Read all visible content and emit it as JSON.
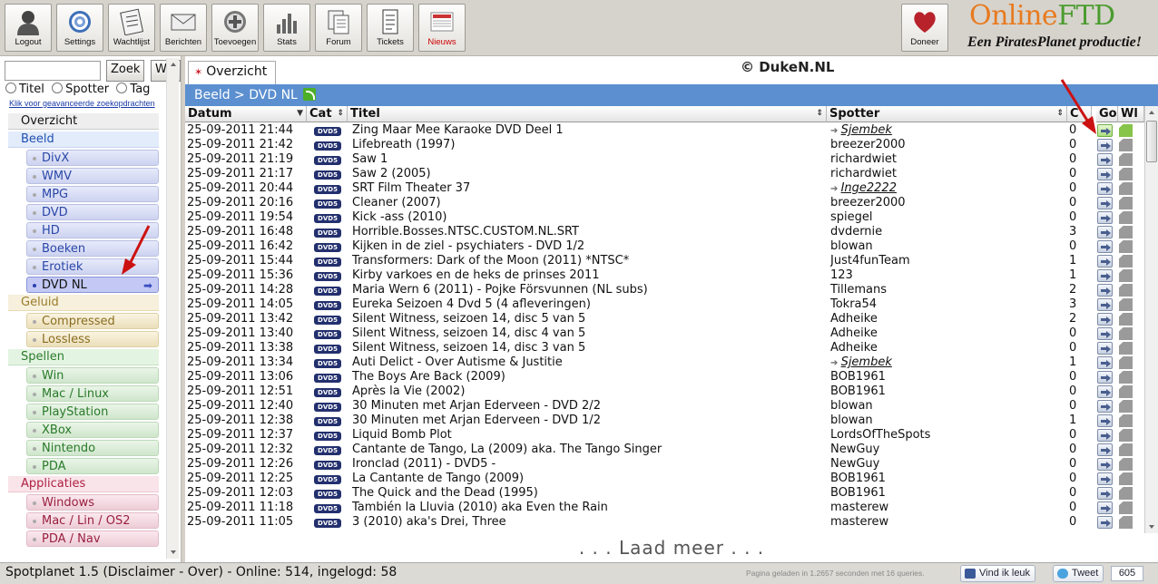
{
  "toolbar": {
    "buttons": [
      {
        "id": "logout",
        "label": "Logout",
        "icon": "user-icon"
      },
      {
        "id": "settings",
        "label": "Settings",
        "icon": "settings-icon"
      },
      {
        "id": "wachtlijst",
        "label": "Wachtlijst",
        "icon": "checklist-icon"
      },
      {
        "id": "berichten",
        "label": "Berichten",
        "icon": "envelope-icon"
      },
      {
        "id": "toevoegen",
        "label": "Toevoegen",
        "icon": "add-icon"
      },
      {
        "id": "stats",
        "label": "Stats",
        "icon": "bar-chart-icon"
      },
      {
        "id": "forum",
        "label": "Forum",
        "icon": "documents-icon"
      },
      {
        "id": "tickets",
        "label": "Tickets",
        "icon": "ticket-icon"
      },
      {
        "id": "nieuws",
        "label": "Nieuws",
        "icon": "newspaper-icon"
      }
    ],
    "donate_label": "Doneer",
    "brand_online": "Online",
    "brand_ftd": "FTD",
    "brand_tagline": "Een PiratesPlanet productie!"
  },
  "sidebar": {
    "search_value": "",
    "zoek_label": "Zoek",
    "wis_label": "Wis",
    "radio_titel": "Titel",
    "radio_spotter": "Spotter",
    "radio_tag": "Tag",
    "advanced_link": "Klik voor geavanceerde zoekopdrachten",
    "nav": [
      {
        "type": "main",
        "label": "Overzicht",
        "cls": "c-overzicht"
      },
      {
        "type": "main",
        "label": "Beeld",
        "cls": "c-beeld"
      },
      {
        "type": "sub",
        "label": "DivX",
        "cls": "c-beeld-sub"
      },
      {
        "type": "sub",
        "label": "WMV",
        "cls": "c-beeld-sub"
      },
      {
        "type": "sub",
        "label": "MPG",
        "cls": "c-beeld-sub"
      },
      {
        "type": "sub",
        "label": "DVD",
        "cls": "c-beeld-sub"
      },
      {
        "type": "sub",
        "label": "HD",
        "cls": "c-beeld-sub"
      },
      {
        "type": "sub",
        "label": "Boeken",
        "cls": "c-beeld-sub"
      },
      {
        "type": "sub",
        "label": "Erotiek",
        "cls": "c-beeld-sub"
      },
      {
        "type": "sub",
        "label": "DVD NL",
        "cls": "c-dvdnl",
        "active": true
      },
      {
        "type": "main",
        "label": "Geluid",
        "cls": "c-geluid"
      },
      {
        "type": "sub",
        "label": "Compressed",
        "cls": "c-geluid-sub"
      },
      {
        "type": "sub",
        "label": "Lossless",
        "cls": "c-geluid-sub"
      },
      {
        "type": "main",
        "label": "Spellen",
        "cls": "c-spellen"
      },
      {
        "type": "sub",
        "label": "Win",
        "cls": "c-spellen-sub"
      },
      {
        "type": "sub",
        "label": "Mac / Linux",
        "cls": "c-spellen-sub"
      },
      {
        "type": "sub",
        "label": "PlayStation",
        "cls": "c-spellen-sub"
      },
      {
        "type": "sub",
        "label": "XBox",
        "cls": "c-spellen-sub"
      },
      {
        "type": "sub",
        "label": "Nintendo",
        "cls": "c-spellen-sub"
      },
      {
        "type": "sub",
        "label": "PDA",
        "cls": "c-spellen-sub"
      },
      {
        "type": "main",
        "label": "Applicaties",
        "cls": "c-app"
      },
      {
        "type": "sub",
        "label": "Windows",
        "cls": "c-app-sub"
      },
      {
        "type": "sub",
        "label": "Mac / Lin / OS2",
        "cls": "c-app-sub"
      },
      {
        "type": "sub",
        "label": "PDA / Nav",
        "cls": "c-app-sub"
      }
    ]
  },
  "main": {
    "tab_label": "Overzicht",
    "watermark": "© DukeN.NL",
    "breadcrumb": "Beeld > DVD NL",
    "columns": {
      "datum": "Datum",
      "cat": "Cat",
      "titel": "Titel",
      "spotter": "Spotter",
      "c": "C",
      "go": "Go",
      "wl": "Wl"
    },
    "category_badge": "DVD5",
    "rows": [
      {
        "datum": "25-09-2011 21:44",
        "titel": "Zing Maar Mee Karaoke DVD Deel 1",
        "spotter": "Sjembek",
        "trusted": true,
        "c": "0"
      },
      {
        "datum": "25-09-2011 21:42",
        "titel": "Lifebreath (1997)",
        "spotter": "breezer2000",
        "trusted": false,
        "c": "0"
      },
      {
        "datum": "25-09-2011 21:19",
        "titel": "Saw 1",
        "spotter": "richardwiet",
        "trusted": false,
        "c": "0"
      },
      {
        "datum": "25-09-2011 21:17",
        "titel": "Saw 2 (2005)",
        "spotter": "richardwiet",
        "trusted": false,
        "c": "0"
      },
      {
        "datum": "25-09-2011 20:44",
        "titel": "SRT Film Theater 37",
        "spotter": "Inge2222",
        "trusted": true,
        "c": "0"
      },
      {
        "datum": "25-09-2011 20:16",
        "titel": "Cleaner (2007)",
        "spotter": "breezer2000",
        "trusted": false,
        "c": "0"
      },
      {
        "datum": "25-09-2011 19:54",
        "titel": "Kick -ass (2010)",
        "spotter": "spiegel",
        "trusted": false,
        "c": "0"
      },
      {
        "datum": "25-09-2011 16:48",
        "titel": "Horrible.Bosses.NTSC.CUSTOM.NL.SRT",
        "spotter": "dvdernie",
        "trusted": false,
        "c": "3"
      },
      {
        "datum": "25-09-2011 16:42",
        "titel": "Kijken in de ziel - psychiaters - DVD 1/2",
        "spotter": "blowan",
        "trusted": false,
        "c": "0"
      },
      {
        "datum": "25-09-2011 15:44",
        "titel": "Transformers: Dark of the Moon (2011) *NTSC*",
        "spotter": "Just4funTeam",
        "trusted": false,
        "c": "1"
      },
      {
        "datum": "25-09-2011 15:36",
        "titel": "Kirby varkoes en de heks de prinses 2011",
        "spotter": "123",
        "trusted": false,
        "c": "1"
      },
      {
        "datum": "25-09-2011 14:28",
        "titel": "Maria Wern 6 (2011) - Pojke Försvunnen (NL subs)",
        "spotter": "Tillemans",
        "trusted": false,
        "c": "2"
      },
      {
        "datum": "25-09-2011 14:05",
        "titel": "Eureka Seizoen 4 Dvd 5 (4 afleveringen)",
        "spotter": "Tokra54",
        "trusted": false,
        "c": "3"
      },
      {
        "datum": "25-09-2011 13:42",
        "titel": "Silent Witness, seizoen 14, disc 5 van 5",
        "spotter": "Adheike",
        "trusted": false,
        "c": "2"
      },
      {
        "datum": "25-09-2011 13:40",
        "titel": "Silent Witness, seizoen 14, disc 4 van 5",
        "spotter": "Adheike",
        "trusted": false,
        "c": "0"
      },
      {
        "datum": "25-09-2011 13:38",
        "titel": "Silent Witness, seizoen 14, disc 3 van 5",
        "spotter": "Adheike",
        "trusted": false,
        "c": "0"
      },
      {
        "datum": "25-09-2011 13:34",
        "titel": "Auti Delict - Over Autisme & Justitie",
        "spotter": "Sjembek",
        "trusted": true,
        "c": "1"
      },
      {
        "datum": "25-09-2011 13:06",
        "titel": "The Boys Are Back (2009)",
        "spotter": "BOB1961",
        "trusted": false,
        "c": "0"
      },
      {
        "datum": "25-09-2011 12:51",
        "titel": "Après la Vie (2002)",
        "spotter": "BOB1961",
        "trusted": false,
        "c": "0"
      },
      {
        "datum": "25-09-2011 12:40",
        "titel": "30 Minuten met Arjan Ederveen - DVD 2/2",
        "spotter": "blowan",
        "trusted": false,
        "c": "0"
      },
      {
        "datum": "25-09-2011 12:38",
        "titel": "30 Minuten met Arjan Ederveen - DVD 1/2",
        "spotter": "blowan",
        "trusted": false,
        "c": "1"
      },
      {
        "datum": "25-09-2011 12:37",
        "titel": "Liquid Bomb Plot",
        "spotter": "LordsOfTheSpots",
        "trusted": false,
        "c": "0"
      },
      {
        "datum": "25-09-2011 12:32",
        "titel": "Cantante de Tango, La (2009) aka. The Tango Singer",
        "spotter": "NewGuy",
        "trusted": false,
        "c": "0"
      },
      {
        "datum": "25-09-2011 12:26",
        "titel": "Ironclad (2011) - DVD5 -",
        "spotter": "NewGuy",
        "trusted": false,
        "c": "0"
      },
      {
        "datum": "25-09-2011 12:25",
        "titel": "La Cantante de Tango (2009)",
        "spotter": "BOB1961",
        "trusted": false,
        "c": "0"
      },
      {
        "datum": "25-09-2011 12:03",
        "titel": "The Quick and the Dead (1995)",
        "spotter": "BOB1961",
        "trusted": false,
        "c": "0"
      },
      {
        "datum": "25-09-2011 11:18",
        "titel": "También la Lluvia (2010) aka Even the Rain",
        "spotter": "masterew",
        "trusted": false,
        "c": "0"
      },
      {
        "datum": "25-09-2011 11:05",
        "titel": "3 (2010) aka's Drei, Three",
        "spotter": "masterew",
        "trusted": false,
        "c": "0"
      }
    ],
    "load_more": ". . . Laad meer . . ."
  },
  "statusbar": {
    "text": "Spotplanet 1.5 (Disclaimer - Over) - Online: 514, ingelogd: 58",
    "page_info": "Pagina geladen in 1.2657 seconden met 16 queries.",
    "like_label": "Vind ik leuk",
    "tweet_label": "Tweet",
    "tweet_count": "605"
  },
  "colors": {
    "accent_blue": "#5b8fd0",
    "badge": "#23306e",
    "annotation_red": "#cc1111"
  }
}
